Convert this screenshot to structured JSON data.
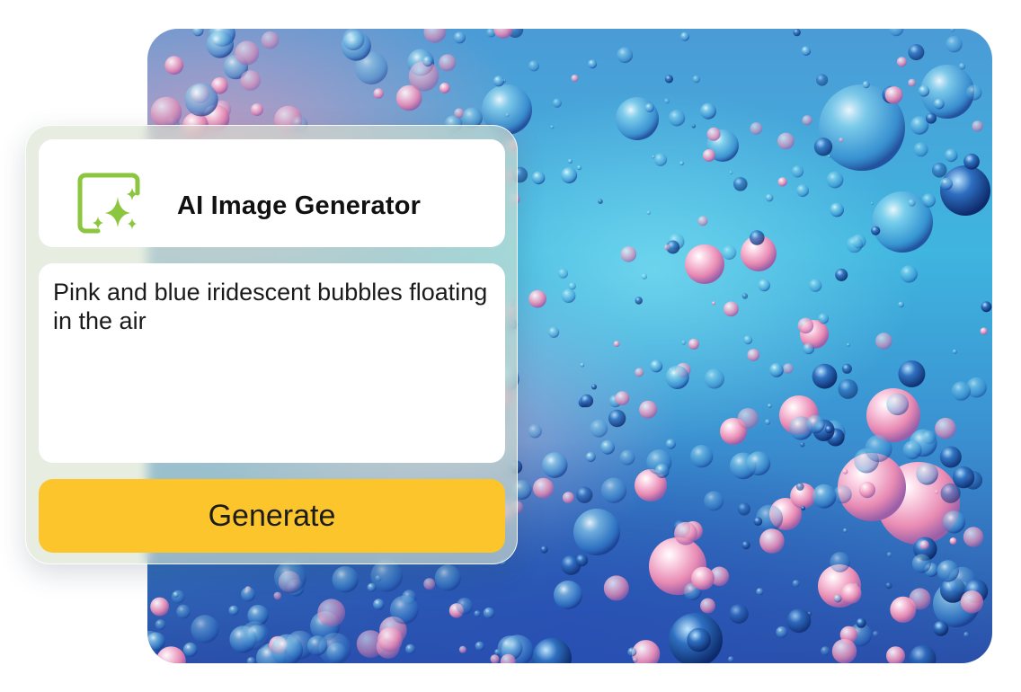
{
  "artwork": {
    "icon": "bubbles-image",
    "colors": {
      "pink": "#f4a6c6",
      "cyan": "#4fc3e6",
      "deep_blue": "#2a4fa8"
    }
  },
  "generator": {
    "title": "AI Image Generator",
    "title_icon": "image-sparkle-icon",
    "prompt_text": "Pink and blue iridescent bubbles floating in the air",
    "generate_label": "Generate",
    "accent_color": "#8cc63f",
    "button_color": "#fcc52c"
  }
}
